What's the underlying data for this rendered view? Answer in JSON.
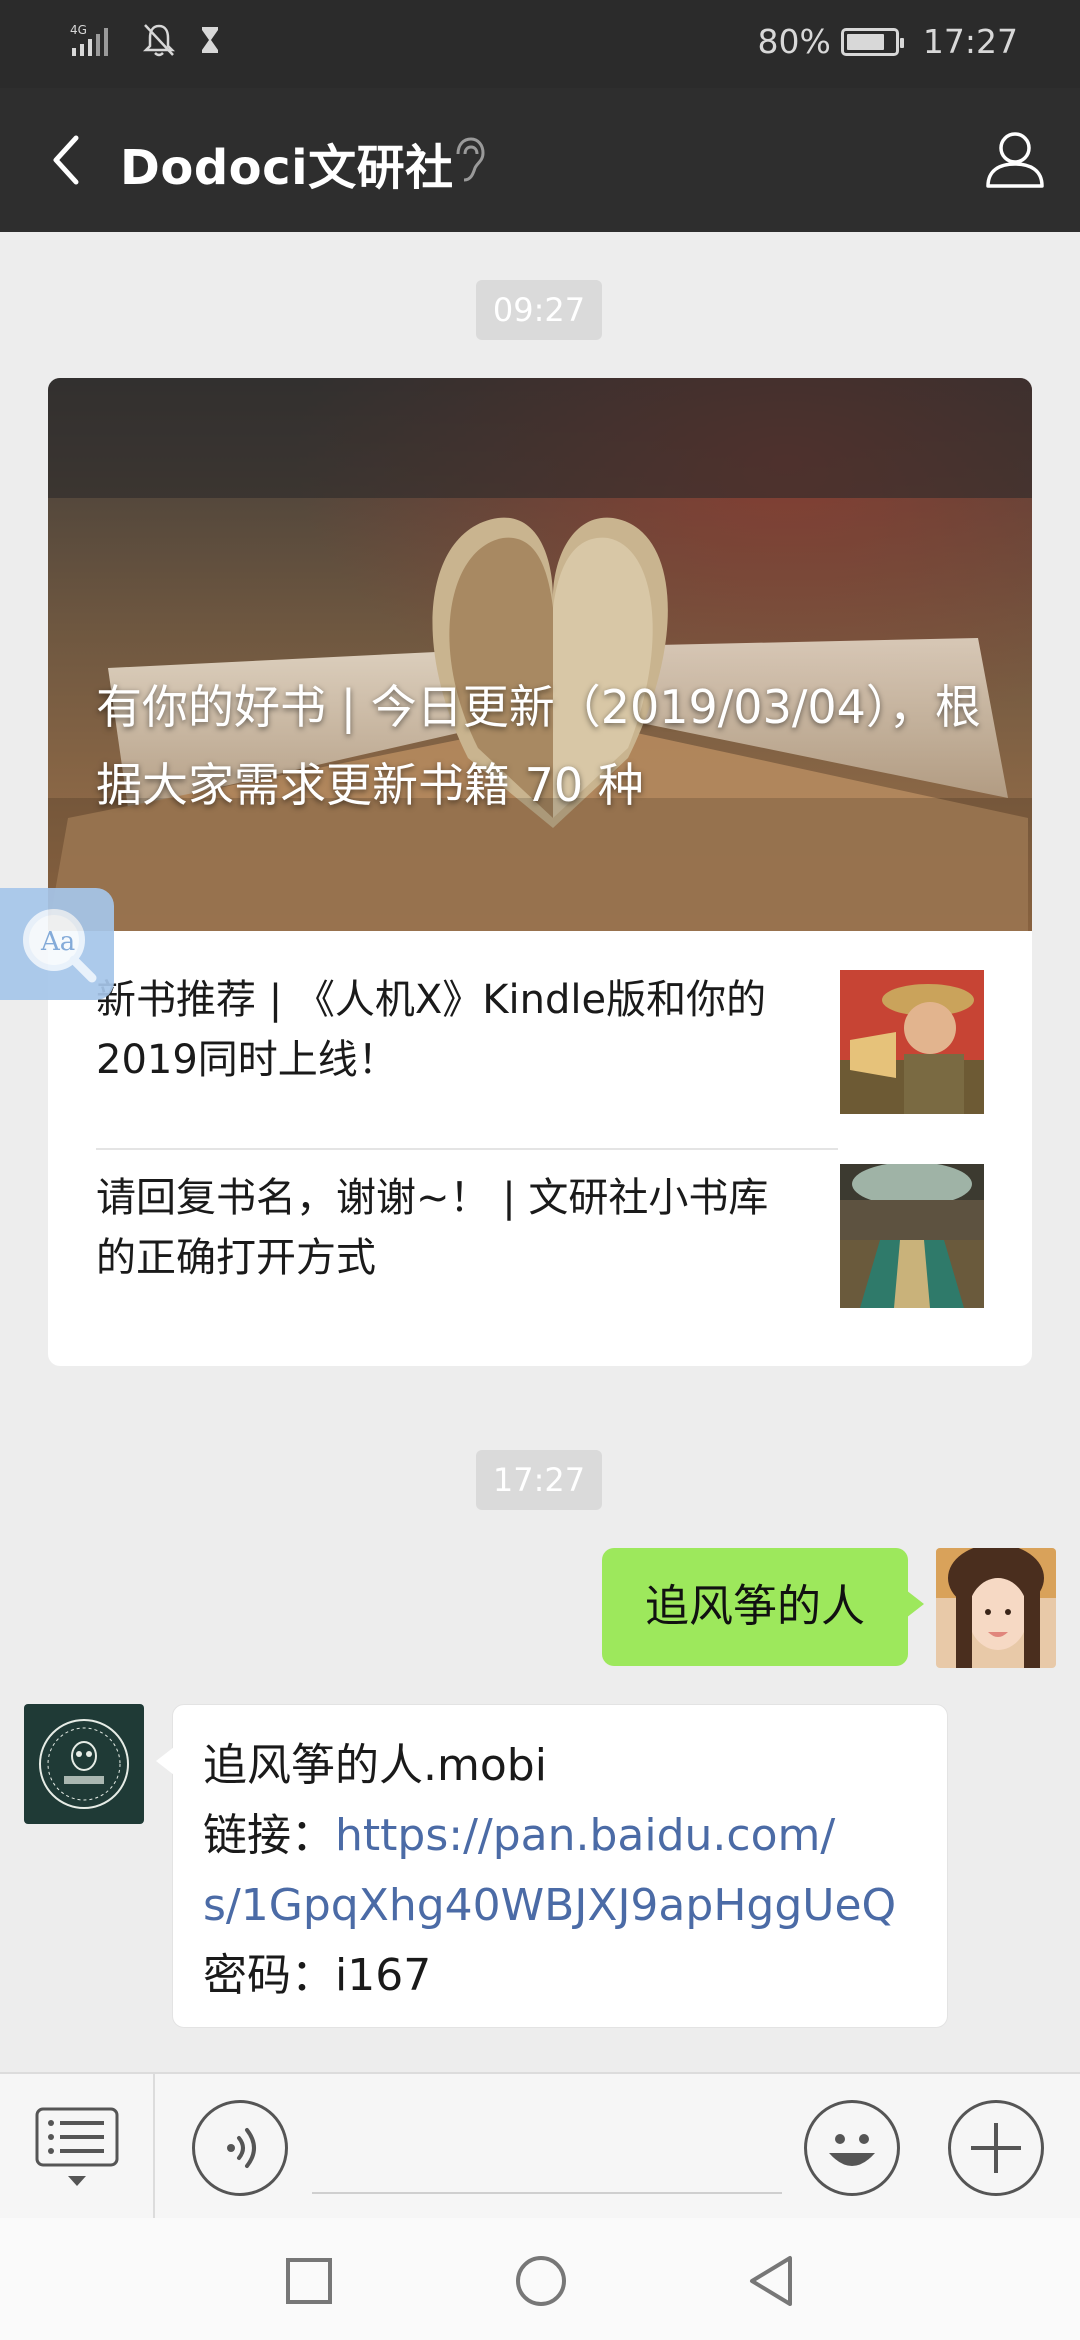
{
  "status_bar": {
    "network": "4G",
    "battery_text": "80%",
    "battery_level": 0.8,
    "time": "17:27"
  },
  "nav": {
    "back_icon": "chevron-left-icon",
    "title": "Dodoci文研社",
    "ear_icon": "ear-icon",
    "profile_icon": "person-icon"
  },
  "timestamps": {
    "first": "09:27",
    "second": "17:27"
  },
  "article_card": {
    "cover_title": "有你的好书 | 今日更新（2019/03/04），根据大家需求更新书籍 70 种",
    "items": [
      {
        "title": "新书推荐 | 《人机X》Kindle版和你的2019同时上线！"
      },
      {
        "title": "请回复书名，谢谢~！ | 文研社小书库的正确打开方式"
      }
    ]
  },
  "messages": {
    "sent": {
      "text": "追风筝的人"
    },
    "received": {
      "filename": "追风筝的人.mobi",
      "link_label": "链接：",
      "link_url": "https://pan.baidu.com/s/1GpqXhg40WBJXJ9apHggUeQ",
      "password_label": "密码：",
      "password": "i167"
    }
  },
  "input_bar": {
    "menu_icon": "menu-list-icon",
    "voice_icon": "voice-icon",
    "emoji_icon": "emoji-icon",
    "plus_icon": "plus-icon"
  },
  "android_nav": {
    "recents_icon": "square-icon",
    "home_icon": "circle-icon",
    "back_icon": "triangle-back-icon"
  },
  "colors": {
    "accent_green": "#9de85c",
    "link_blue": "#4b6ba6",
    "nav_dark": "#2e2e2e"
  }
}
